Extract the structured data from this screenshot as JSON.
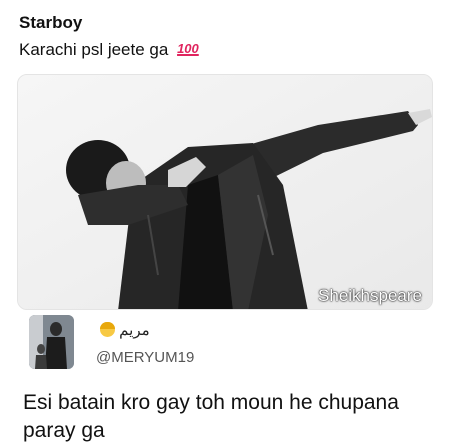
{
  "tweet": {
    "author": "Starboy",
    "text": "Karachi psl jeete ga",
    "emoji": "💯",
    "image": {
      "description_icon": "dabbing-man-photo",
      "watermark": "Sheikhspeare"
    }
  },
  "reply": {
    "name": "مريم",
    "name_emoji": "woman-emoji",
    "handle": "@MERYUM19",
    "text": "Esi batain kro gay toh moun he chupana paray ga"
  }
}
